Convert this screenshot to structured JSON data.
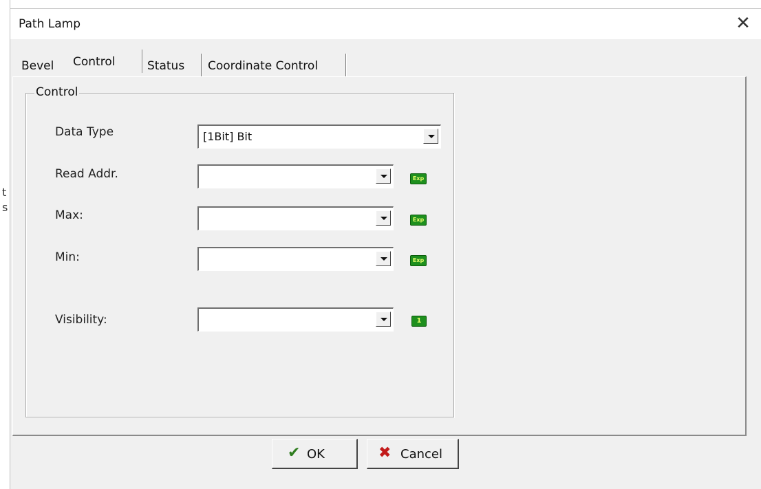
{
  "window": {
    "title": "Path Lamp",
    "close_glyph": "✕"
  },
  "background_fragments": [
    "t",
    "s"
  ],
  "tabs": [
    {
      "label": "Bevel",
      "active": false
    },
    {
      "label": "Control",
      "active": true
    },
    {
      "label": "Status",
      "active": false
    },
    {
      "label": "Coordinate Control",
      "active": false
    }
  ],
  "group": {
    "title": "Control"
  },
  "fields": {
    "data_type": {
      "label": "Data Type",
      "value": "[1Bit] Bit"
    },
    "read_addr": {
      "label": "Read Addr.",
      "value": "",
      "badge": "Exp"
    },
    "max": {
      "label": "Max:",
      "value": "",
      "badge": "Exp"
    },
    "min": {
      "label": "Min:",
      "value": "",
      "badge": "Exp"
    },
    "visibility": {
      "label": "Visibility:",
      "value": "",
      "badge": "1"
    }
  },
  "buttons": {
    "ok": {
      "label": "OK",
      "icon": "check-icon",
      "icon_color": "#2f7d1f"
    },
    "cancel": {
      "label": "Cancel",
      "icon": "x-icon",
      "icon_color": "#c21a1a"
    }
  },
  "colors": {
    "dialog_bg": "#f0f0f0",
    "badge_green": "#1e8f1e"
  }
}
